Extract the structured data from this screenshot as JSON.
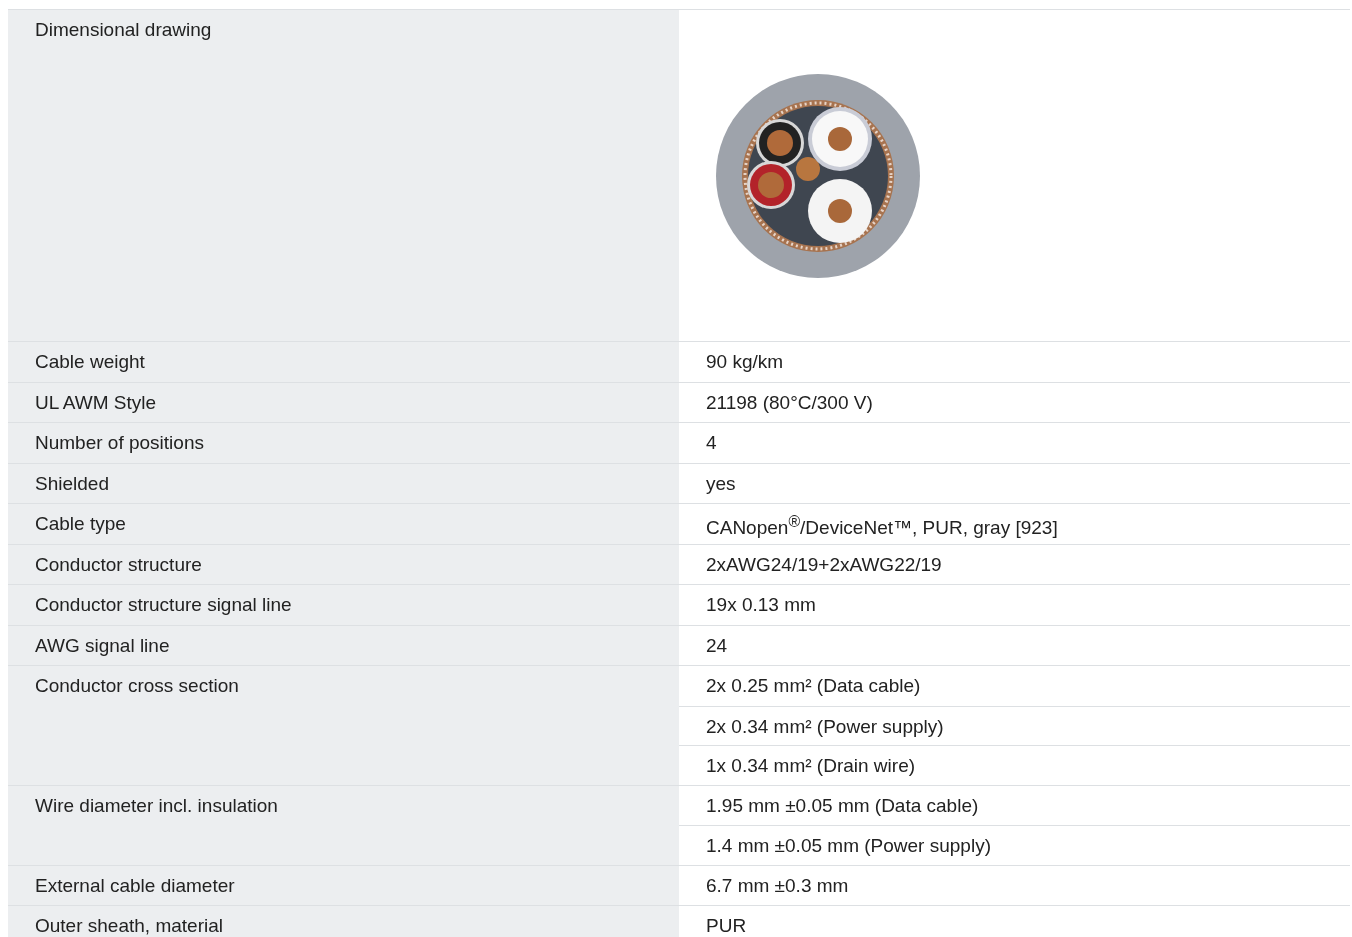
{
  "rows": [
    {
      "kind": "drawing",
      "label": "Dimensional drawing"
    },
    {
      "kind": "text",
      "label": "Cable weight",
      "values": [
        "90 kg/km"
      ]
    },
    {
      "kind": "text",
      "label": "UL AWM Style",
      "values": [
        "21198 (80°C/300 V)"
      ]
    },
    {
      "kind": "text",
      "label": "Number of positions",
      "values": [
        "4"
      ]
    },
    {
      "kind": "text",
      "label": "Shielded",
      "values": [
        "yes"
      ]
    },
    {
      "kind": "text",
      "label": "Cable type",
      "values": [
        "CANopen$^{®}$/DeviceNet™, PUR, gray [923]"
      ]
    },
    {
      "kind": "text",
      "label": "Conductor structure",
      "values": [
        "2xAWG24/19+2xAWG22/19"
      ]
    },
    {
      "kind": "text",
      "label": "Conductor structure signal line",
      "values": [
        "19x 0.13 mm"
      ]
    },
    {
      "kind": "text",
      "label": "AWG signal line",
      "values": [
        "24"
      ]
    },
    {
      "kind": "text",
      "label": "Conductor cross section",
      "values": [
        "2x 0.25 mm² (Data cable)",
        "2x 0.34 mm² (Power supply)",
        "1x 0.34 mm² (Drain wire)"
      ]
    },
    {
      "kind": "text",
      "label": "Wire diameter incl. insulation",
      "values": [
        "1.95 mm ±0.05 mm (Data cable)",
        "1.4 mm ±0.05 mm (Power supply)"
      ]
    },
    {
      "kind": "text",
      "label": "External cable diameter",
      "values": [
        "6.7 mm ±0.3 mm"
      ]
    },
    {
      "kind": "text",
      "label": "Outer sheath, material",
      "values": [
        "PUR"
      ]
    }
  ]
}
